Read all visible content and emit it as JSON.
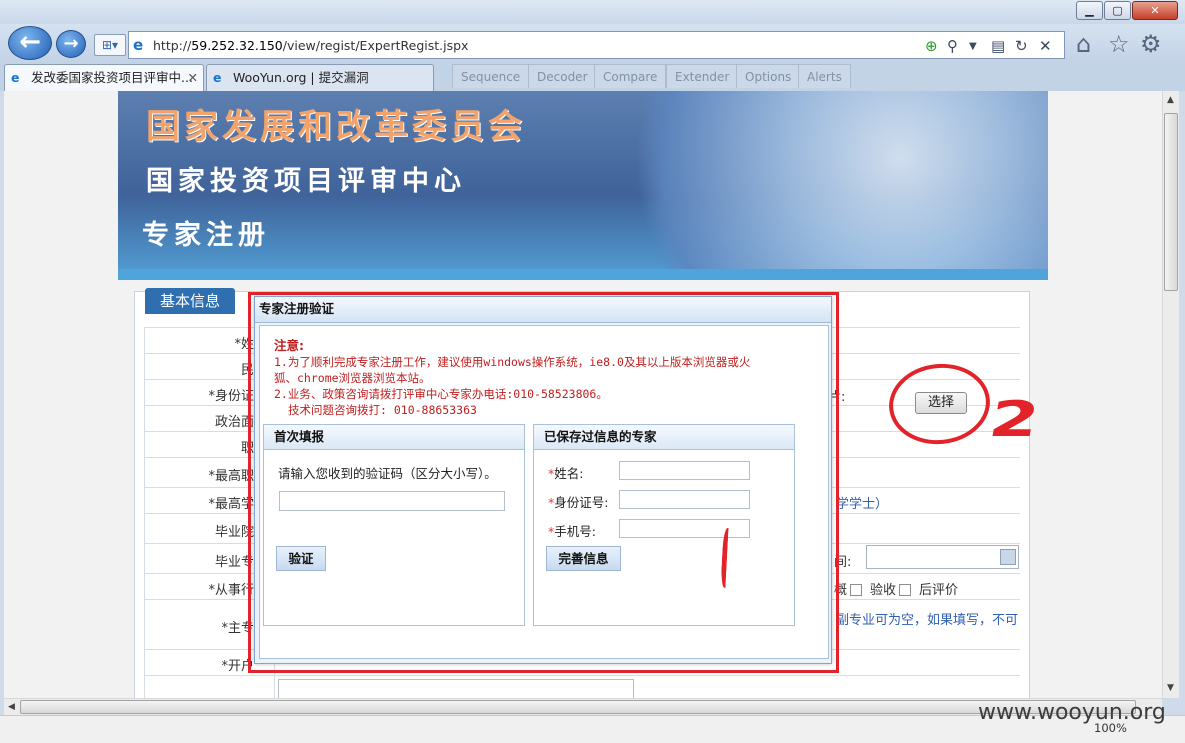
{
  "browser": {
    "address_url": "http://59.252.32.150/view/regist/ExpertRegist.jspx",
    "address_prefix": "http://",
    "address_domain": "59.252.32.150",
    "address_path": "/view/regist/ExpertRegist.jspx",
    "tabs": [
      {
        "label": "发改委国家投资项目评审中..."
      },
      {
        "label": "WooYun.org | 提交漏洞"
      }
    ],
    "ghost_tabs": [
      "Sequence",
      "Decoder",
      "Compare",
      "Extender",
      "Options",
      "Alerts"
    ],
    "zoom": "100%",
    "watermark": "www.wooyun.org",
    "window_buttons": {
      "min": "▁",
      "max": "▢",
      "close": "✕"
    }
  },
  "banner": {
    "line1": "国家发展和改革委员会",
    "line2": "国家投资项目评审中心",
    "line3": "专家注册"
  },
  "form": {
    "tab_label": "基本信息",
    "labels": [
      "*姓",
      "民",
      "*身份证",
      "政治面",
      "职",
      "*最高职",
      "*最高学",
      "毕业院",
      "毕业专",
      "*从事行",
      "*主专",
      "*开户"
    ],
    "photo_label": "片:",
    "select_button": "选择",
    "degree_hint": "学学士）",
    "date_label": "间:",
    "checks": [
      "概",
      "验收",
      "后评价"
    ],
    "major_hint": "副专业可为空，如果填写，不可"
  },
  "modal": {
    "title": "专家注册验证",
    "notice_title": "注意:",
    "notice_line1": "1.为了顺利完成专家注册工作，建议使用windows操作系统，ie8.0及其以上版本浏览器或火",
    "notice_line2": "狐、chrome浏览器浏览本站。",
    "notice_line3": "2.业务、政策咨询请拨打评审中心专家办电话:010-58523806。",
    "notice_line4": "技术问题咨询拨打: 010-88653363",
    "first_fill": {
      "header": "首次填报",
      "prompt": "请输入您收到的验证码（区分大小写）。",
      "button": "验证"
    },
    "saved": {
      "header": "已保存过信息的专家",
      "name_label": "姓名:",
      "id_label": "身份证号:",
      "phone_label": "手机号:",
      "button": "完善信息"
    }
  },
  "annotations": {
    "mark1": "1",
    "mark2": "2"
  }
}
